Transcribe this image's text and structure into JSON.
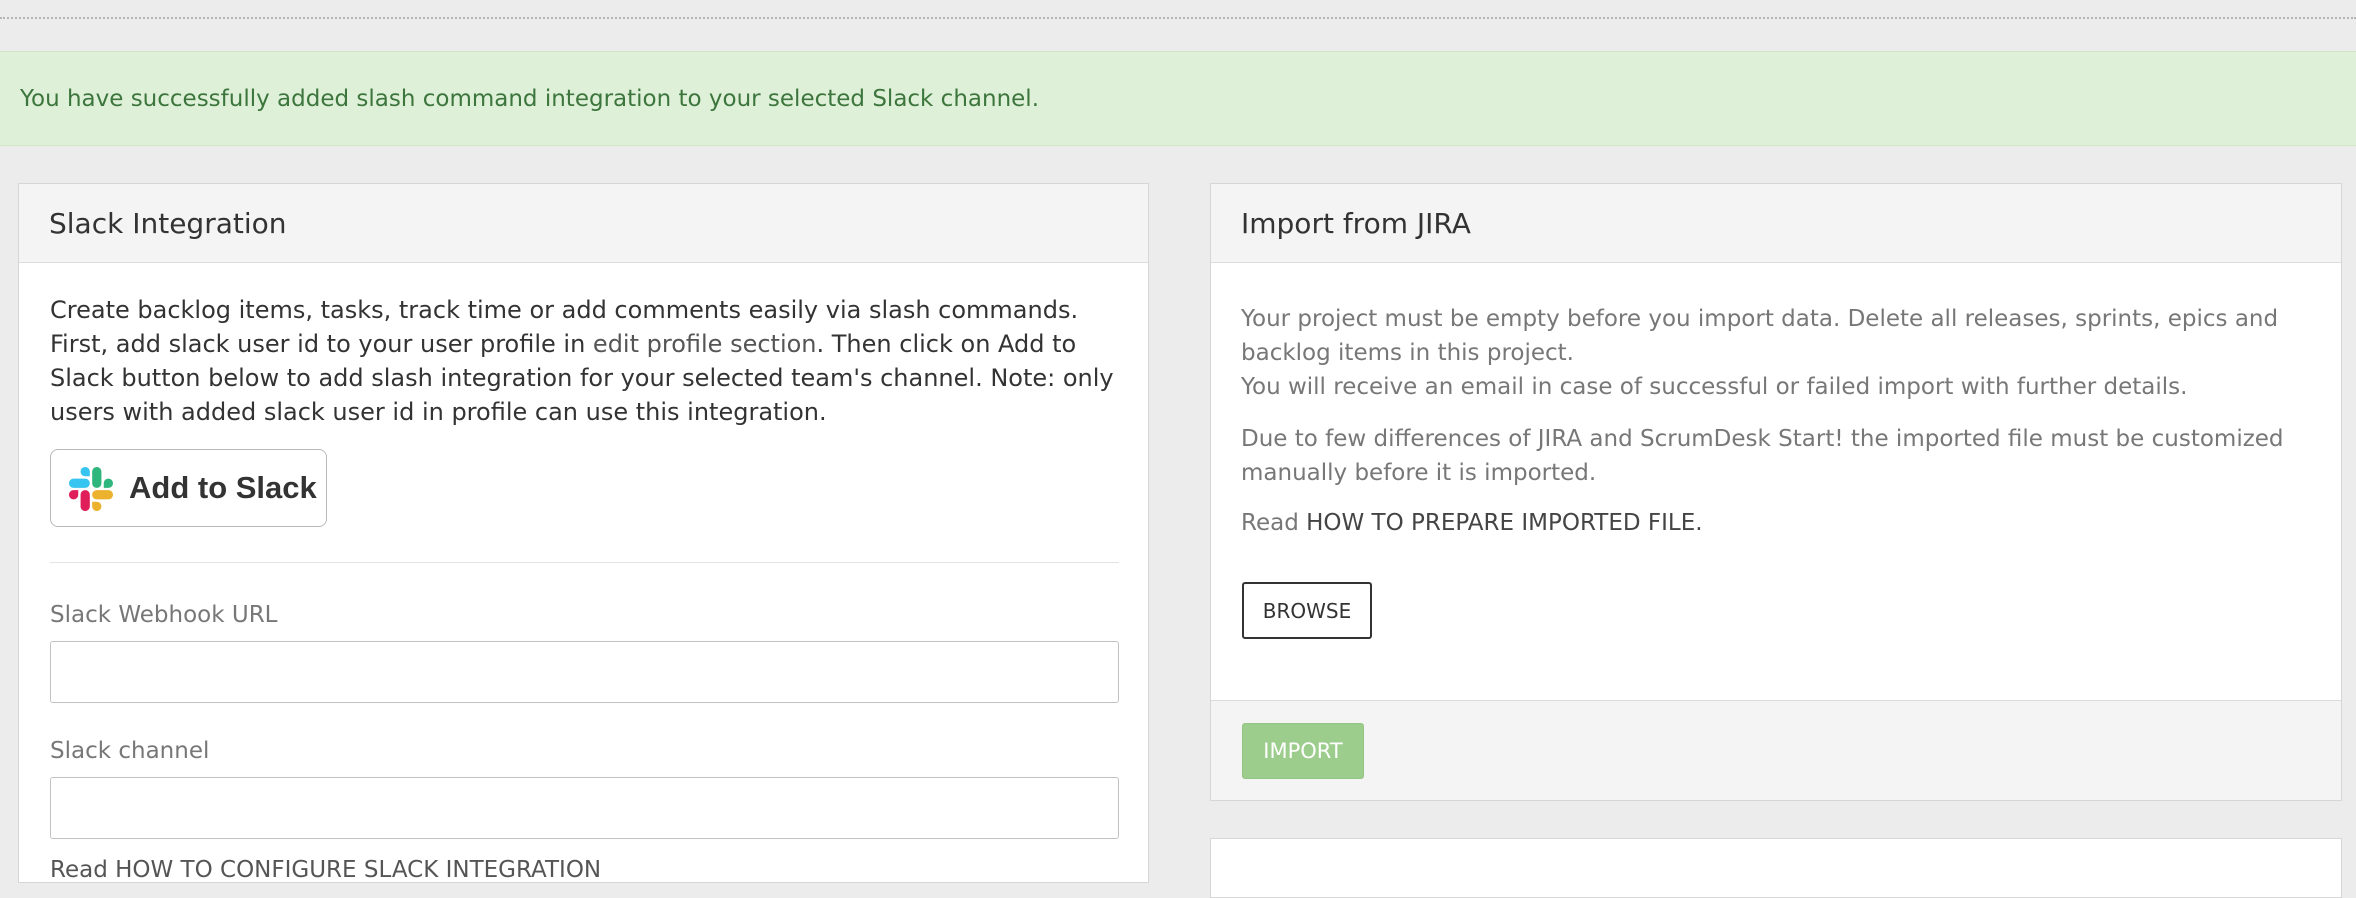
{
  "alert": {
    "message": "You have successfully added slash command integration to your selected Slack channel."
  },
  "slack": {
    "title": "Slack Integration",
    "desc_part1": "Create backlog items, tasks, track time or add comments easily via slash commands. First, add slack user id to your user profile in ",
    "edit_profile_link": "edit profile section",
    "desc_part2": ". Then click on Add to Slack button below to add slash integration for your selected team's channel. Note: only users with added slack user id in profile can use this integration.",
    "add_button_label": "Add to Slack",
    "webhook_label": "Slack Webhook URL",
    "webhook_value": "",
    "channel_label": "Slack channel",
    "channel_value": "",
    "read_more_partial": "Read HOW TO CONFIGURE SLACK INTEGRATION"
  },
  "jira": {
    "title": "Import from JIRA",
    "p1_line1": "Your project must be empty before you import data. Delete all releases, sprints, epics and backlog items in this project.",
    "p1_line2": "You will receive an email in case of successful or failed import with further details.",
    "p2": "Due to few differences of JIRA and ScrumDesk Start! the imported file must be customized manually before it is imported.",
    "read_prefix": "Read ",
    "read_link": "HOW TO PREPARE IMPORTED FILE.",
    "browse_label": "BROWSE",
    "import_label": "IMPORT"
  },
  "icons": {
    "slack_logo": "slack-logo-icon"
  },
  "colors": {
    "alert_bg": "#dff0d8",
    "alert_text": "#3c763d",
    "import_button": "#9ccd8c",
    "slack_blue": "#36C5F0",
    "slack_green": "#2EB67D",
    "slack_red": "#E01E5A",
    "slack_yellow": "#ECB22E"
  }
}
